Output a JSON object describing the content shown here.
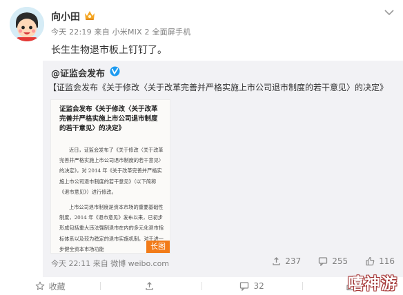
{
  "author": {
    "name": "向小田",
    "meta": "今天 22:19 来自 小米MIX 2 全面屏手机"
  },
  "post": {
    "text": "长生生物退市板上钉钉了。"
  },
  "repost": {
    "author": "@证监会发布",
    "text": "【证监会发布《关于修改〈关于改革完善并严格实施上市公司退市制度的若干意见〉的决定》",
    "document": {
      "title": "证监会发布《关于修改〈关于改革完善并严格实施上市公司退市制度的若干意见〉的决定》",
      "paragraphs": [
        "近日，证监会发布了《关于修改〈关于改革完善并严格实施上市公司退市制度的若干意见〉的决定》，对 2014 年《关于改革完善并严格实施上市公司退市制度的若干意见》（以下简称《退市意见》）进行修改。",
        "上市公司退市制度是资本市场的重要基础性制度，2014 年《退市意见》发布以来，已初步形成包括重大违法强制退市在内的多元化退市指标体系以及较为稳定的退市实施机制，对于进一步健全资本市场功能"
      ],
      "badge": "长图"
    },
    "meta": "今天 22:11 来自 微博 weibo.com",
    "actions": {
      "reposts": "237",
      "comments": "255",
      "likes": "116"
    }
  },
  "footer": {
    "favorite": "收藏",
    "comments": "32"
  },
  "watermark": "嘻神游",
  "colors": {
    "accent_orange": "#f27b18",
    "text_gray": "#808080",
    "repost_bg": "#f2f2f5",
    "verified_blue": "#1e9bf0"
  }
}
